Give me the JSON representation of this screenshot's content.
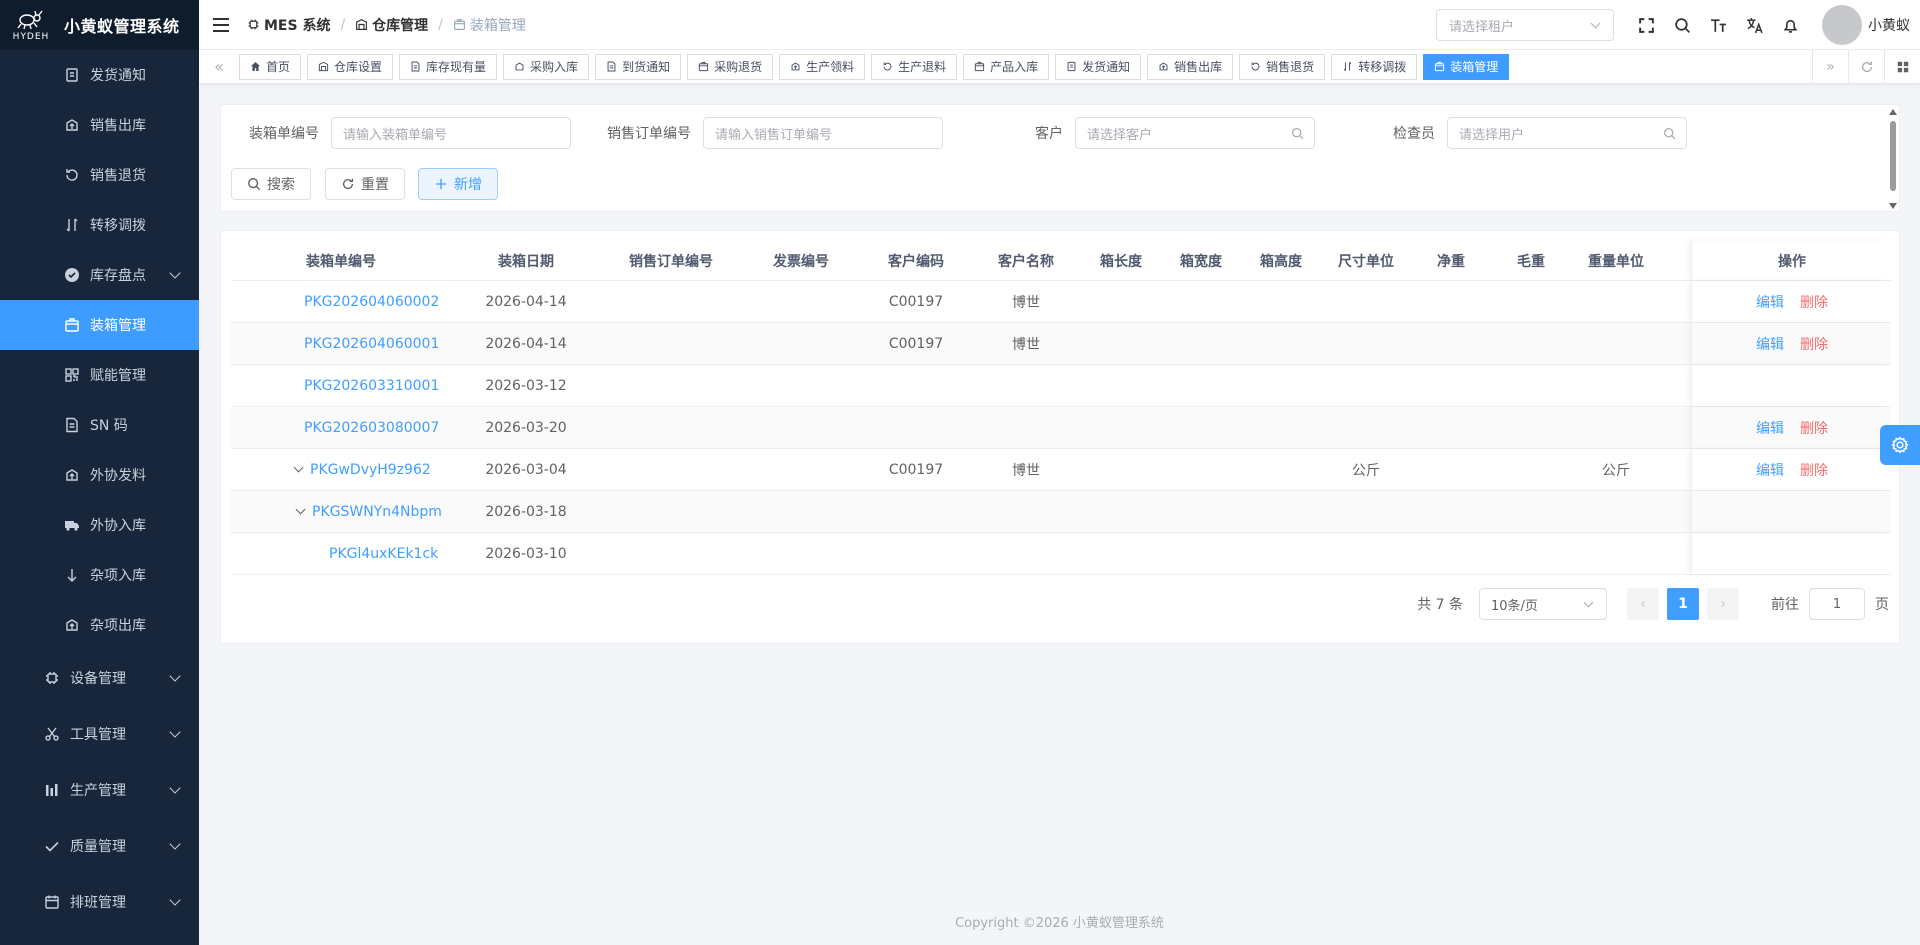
{
  "app": {
    "title": "小黄蚁管理系统",
    "logo_sub": "HYDEH"
  },
  "sidebar": {
    "items": [
      {
        "label": "发货通知",
        "icon": "shipping-notice-icon",
        "type": "child"
      },
      {
        "label": "销售出库",
        "icon": "outbound-icon",
        "type": "child"
      },
      {
        "label": "销售退货",
        "icon": "return-icon",
        "type": "child"
      },
      {
        "label": "转移调拨",
        "icon": "transfer-icon",
        "type": "child"
      },
      {
        "label": "库存盘点",
        "icon": "check-circle-icon",
        "type": "child-group"
      },
      {
        "label": "装箱管理",
        "icon": "box-icon",
        "type": "child",
        "active": true
      },
      {
        "label": "赋能管理",
        "icon": "qrcode-icon",
        "type": "child"
      },
      {
        "label": "SN 码",
        "icon": "document-icon",
        "type": "child"
      },
      {
        "label": "外协发料",
        "icon": "outbound-icon",
        "type": "child"
      },
      {
        "label": "外协入库",
        "icon": "truck-icon",
        "type": "child"
      },
      {
        "label": "杂项入库",
        "icon": "arrow-down-icon",
        "type": "child"
      },
      {
        "label": "杂项出库",
        "icon": "outbound-icon",
        "type": "child"
      },
      {
        "label": "设备管理",
        "icon": "cpu-icon",
        "type": "group"
      },
      {
        "label": "工具管理",
        "icon": "scissors-icon",
        "type": "group"
      },
      {
        "label": "生产管理",
        "icon": "bar-chart-icon",
        "type": "group"
      },
      {
        "label": "质量管理",
        "icon": "check-icon",
        "type": "group"
      },
      {
        "label": "排班管理",
        "icon": "calendar-icon",
        "type": "group"
      }
    ]
  },
  "header": {
    "breadcrumb": [
      "MES 系统",
      "仓库管理",
      "装箱管理"
    ],
    "tenant_placeholder": "请选择租户",
    "user_name": "小黄蚁"
  },
  "tags": [
    {
      "label": "首页",
      "icon": "home-icon"
    },
    {
      "label": "仓库设置",
      "icon": "warehouse-icon"
    },
    {
      "label": "库存现有量",
      "icon": "document-icon"
    },
    {
      "label": "采购入库",
      "icon": "inbound-icon"
    },
    {
      "label": "到货通知",
      "icon": "document-icon"
    },
    {
      "label": "采购退货",
      "icon": "box-icon"
    },
    {
      "label": "生产领料",
      "icon": "outbound-icon"
    },
    {
      "label": "生产退料",
      "icon": "return-icon"
    },
    {
      "label": "产品入库",
      "icon": "box-icon"
    },
    {
      "label": "发货通知",
      "icon": "shipping-notice-icon"
    },
    {
      "label": "销售出库",
      "icon": "outbound-icon"
    },
    {
      "label": "销售退货",
      "icon": "return-icon"
    },
    {
      "label": "转移调拨",
      "icon": "transfer-icon"
    },
    {
      "label": "装箱管理",
      "icon": "box-icon",
      "active": true
    }
  ],
  "search": {
    "fields": [
      {
        "label": "装箱单编号",
        "placeholder": "请输入装箱单编号"
      },
      {
        "label": "销售订单编号",
        "placeholder": "请输入销售订单编号"
      },
      {
        "label": "客户",
        "placeholder": "请选择客户"
      },
      {
        "label": "检查员",
        "placeholder": "请选择用户"
      }
    ],
    "search_btn": "搜索",
    "reset_btn": "重置",
    "add_btn": "新增"
  },
  "table": {
    "columns": [
      "装箱单编号",
      "装箱日期",
      "销售订单编号",
      "发票编号",
      "客户编码",
      "客户名称",
      "箱长度",
      "箱宽度",
      "箱高度",
      "尺寸单位",
      "净重",
      "毛重",
      "重量单位",
      "操作"
    ],
    "rows": [
      {
        "code": "PKG202604060002",
        "date": "2026-04-14",
        "so": "",
        "invoice": "",
        "cust_code": "C00197",
        "cust_name": "博世",
        "len": "",
        "wid": "",
        "hei": "",
        "size_unit": "",
        "net": "",
        "gross": "",
        "weight_unit": "",
        "ops": true,
        "level": 0,
        "expand": false
      },
      {
        "code": "PKG202604060001",
        "date": "2026-04-14",
        "so": "",
        "invoice": "",
        "cust_code": "C00197",
        "cust_name": "博世",
        "len": "",
        "wid": "",
        "hei": "",
        "size_unit": "",
        "net": "",
        "gross": "",
        "weight_unit": "",
        "ops": true,
        "level": 0,
        "expand": false
      },
      {
        "code": "PKG202603310001",
        "date": "2026-03-12",
        "so": "",
        "invoice": "",
        "cust_code": "",
        "cust_name": "",
        "len": "",
        "wid": "",
        "hei": "",
        "size_unit": "",
        "net": "",
        "gross": "",
        "weight_unit": "",
        "ops": false,
        "level": 0,
        "expand": false
      },
      {
        "code": "PKG202603080007",
        "date": "2026-03-20",
        "so": "",
        "invoice": "",
        "cust_code": "",
        "cust_name": "",
        "len": "",
        "wid": "",
        "hei": "",
        "size_unit": "",
        "net": "",
        "gross": "",
        "weight_unit": "",
        "ops": true,
        "level": 0,
        "expand": false
      },
      {
        "code": "PKGwDvyH9z962",
        "date": "2026-03-04",
        "so": "",
        "invoice": "",
        "cust_code": "C00197",
        "cust_name": "博世",
        "len": "",
        "wid": "",
        "hei": "",
        "size_unit": "公斤",
        "net": "",
        "gross": "",
        "weight_unit": "公斤",
        "ops": true,
        "level": 0,
        "expand": true
      },
      {
        "code": "PKGSWNYn4Nbpm",
        "date": "2026-03-18",
        "so": "",
        "invoice": "",
        "cust_code": "",
        "cust_name": "",
        "len": "",
        "wid": "",
        "hei": "",
        "size_unit": "",
        "net": "",
        "gross": "",
        "weight_unit": "",
        "ops": false,
        "level": 1,
        "expand": true
      },
      {
        "code": "PKGl4uxKEk1ck",
        "date": "2026-03-10",
        "so": "",
        "invoice": "",
        "cust_code": "",
        "cust_name": "",
        "len": "",
        "wid": "",
        "hei": "",
        "size_unit": "",
        "net": "",
        "gross": "",
        "weight_unit": "",
        "ops": false,
        "level": 2,
        "expand": false
      }
    ],
    "edit_label": "编辑",
    "delete_label": "删除"
  },
  "pagination": {
    "total": "共 7 条",
    "page_size": "10条/页",
    "current_page": "1",
    "goto_prefix": "前往",
    "goto_value": "1",
    "goto_suffix": "页"
  },
  "footer": "Copyright ©2026 小黄蚁管理系统",
  "colors": {
    "primary": "#409eff",
    "sidebar_bg": "#17263a",
    "active_menu": "#3f9cff",
    "danger": "#f56c6c"
  }
}
